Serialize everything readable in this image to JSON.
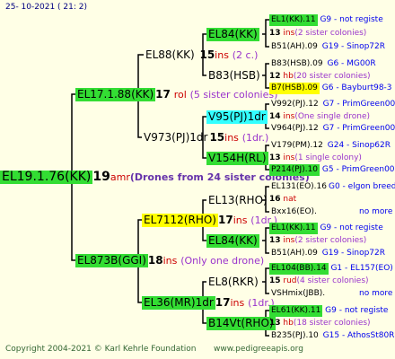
{
  "header": "25-  10-2021  (  21:   2)",
  "footer": {
    "copyright": "Copyright 2004-2021 © Karl Kehrle Foundation",
    "url": "www.pedigreeapis.org"
  },
  "colors": {
    "green": "#33dd33",
    "yellow": "#ffff00",
    "cyan": "#33ffff",
    "line": "#000000"
  },
  "tree": {
    "root": {
      "name": "EL19.1.76(KK)",
      "num": "19",
      "unit": "amr",
      "note": "(Drones from 24 sister colonies)"
    },
    "g1": [
      {
        "name": "EL17.1.88(KK)",
        "num": "17",
        "unit": "rol",
        "note": "(5 sister colonies)"
      },
      {
        "name": "EL873B(GGI)",
        "num": "18",
        "unit": "ins",
        "note": "(Only one drone)"
      }
    ],
    "g2": [
      {
        "name": "EL88(KK)",
        "num": "15",
        "unit": "ins",
        "note": "(2 c.)"
      },
      {
        "name": "V973(PJ)1dr",
        "num": "15",
        "unit": "ins",
        "note": "(1dr.)"
      },
      {
        "name": "EL7112(RHO)",
        "num": "17",
        "unit": "ins",
        "note": "(1dr.)"
      },
      {
        "name": "EL36(MR)1dr",
        "num": "17",
        "unit": "ins",
        "note": "(1dr.)"
      }
    ],
    "g3": [
      {
        "name": "EL84(KK)"
      },
      {
        "name": "B83(HSB)"
      },
      {
        "name": "V95(PJ)1dr"
      },
      {
        "name": "V154H(RL)"
      },
      {
        "name": "EL13(RHO)"
      },
      {
        "name": "EL84(KK)"
      },
      {
        "name": "EL8(RKR)"
      },
      {
        "name": "B14Vt(RHO)"
      }
    ],
    "g4": [
      {
        "name": "EL1(KK).11",
        "info": "G9 - not registe"
      },
      {
        "num": "13",
        "unit": "ins",
        "note": "(2 sister colonies)"
      },
      {
        "name": "B51(AH).09",
        "info": "G19 - Sinop72R"
      },
      {
        "name": "B83(HSB).09",
        "info": "G6 - MG00R"
      },
      {
        "num": "12",
        "unit": "hb",
        "note": "(20 sister colonies)"
      },
      {
        "name": "B7(HSB).09",
        "info": "G6 - Bayburt98-3"
      },
      {
        "name": "V992(PJ).12",
        "info": "G7 - PrimGreen00"
      },
      {
        "num": "14",
        "unit": "ins",
        "note": "(One single drone)"
      },
      {
        "name": "V964(PJ).12",
        "info": "G7 - PrimGreen00"
      },
      {
        "name": "V179(PM).12",
        "info": "G24 - Sinop62R"
      },
      {
        "num": "13",
        "unit": "ins",
        "note": "(1 single colony)"
      },
      {
        "name": "P214(PJ).10",
        "info": "G5 - PrimGreen00"
      },
      {
        "name": "EL131(EO).16",
        "info": "G0 - elgon breed"
      },
      {
        "num": "16",
        "unit": "nat",
        "note": ""
      },
      {
        "name": "Bxx16(EO).",
        "info": "no more"
      },
      {
        "name": "EL1(KK).11",
        "info": "G9 - not registe"
      },
      {
        "num": "13",
        "unit": "ins",
        "note": "(2 sister colonies)"
      },
      {
        "name": "B51(AH).09",
        "info": "G19 - Sinop72R"
      },
      {
        "name": "EL104(BB).14",
        "info": "G1 - EL157(EO)"
      },
      {
        "num": "15",
        "unit": "rud",
        "note": "(4 sister colonies)"
      },
      {
        "name": "VSHmix(JBB).",
        "info": "no more"
      },
      {
        "name": "EL61(KK).11",
        "info": "G9 - not registe"
      },
      {
        "num": "13",
        "unit": "hb",
        "note": "(18 sister colonies)"
      },
      {
        "name": "B235(PJ).10",
        "info": "G15 - AthosSt80R"
      }
    ]
  }
}
